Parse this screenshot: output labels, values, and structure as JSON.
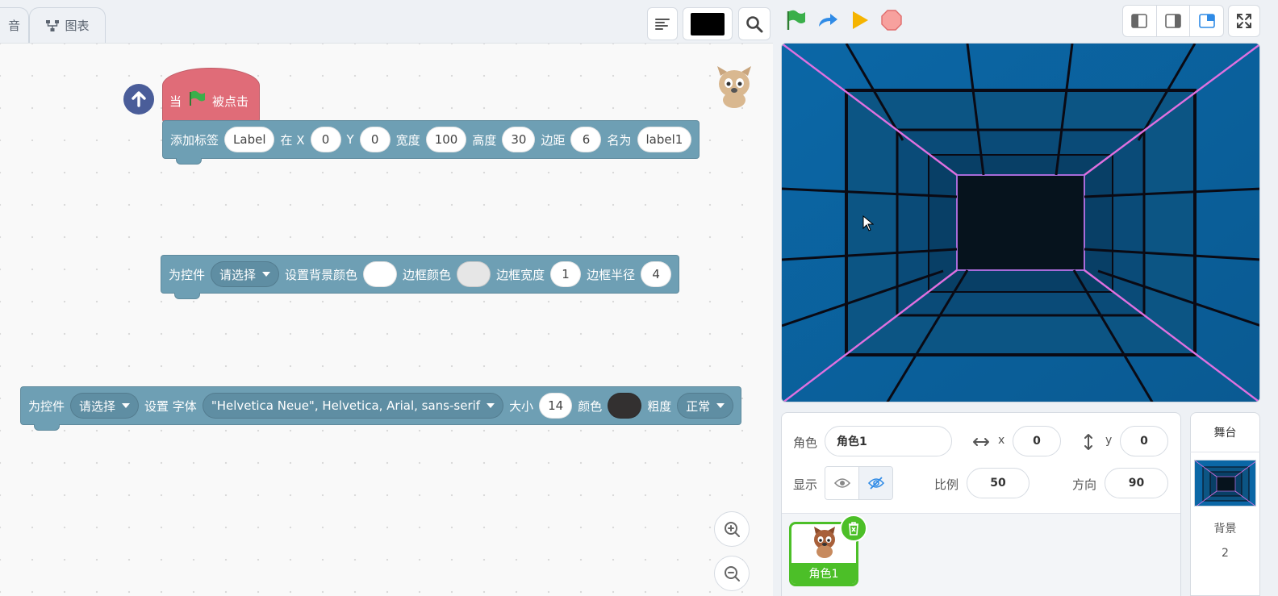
{
  "tabs": {
    "partial_label": "音",
    "chart_label": "图表"
  },
  "blocks": {
    "hat": {
      "prefix": "当",
      "suffix": "被点击"
    },
    "add_label": {
      "cmd": "添加标签",
      "text_value": "Label",
      "x_label": "在 X",
      "x_value": "0",
      "y_label": "Y",
      "y_value": "0",
      "width_label": "宽度",
      "width_value": "100",
      "height_label": "高度",
      "height_value": "30",
      "margin_label": "边距",
      "margin_value": "6",
      "name_label": "名为",
      "name_value": "label1"
    },
    "set_bg": {
      "cmd": "为控件",
      "select_value": "请选择",
      "bg_label": "设置背景颜色",
      "bg_color": "#ffffff",
      "border_color_label": "边框颜色",
      "border_color": "#e6e6e6",
      "border_width_label": "边框宽度",
      "border_width_value": "1",
      "border_radius_label": "边框半径",
      "border_radius_value": "4"
    },
    "set_font": {
      "cmd": "为控件",
      "select_value": "请选择",
      "font_label": "设置 字体",
      "font_value": "\"Helvetica Neue\", Helvetica, Arial, sans-serif",
      "size_label": "大小",
      "size_value": "14",
      "color_label": "颜色",
      "color_value": "#333030",
      "weight_label": "粗度",
      "weight_value": "正常"
    }
  },
  "sprite": {
    "name_label": "角色",
    "name_value": "角色1",
    "x_label": "x",
    "x_value": "0",
    "y_label": "y",
    "y_value": "0",
    "show_label": "显示",
    "scale_label": "比例",
    "scale_value": "50",
    "direction_label": "方向",
    "direction_value": "90",
    "tile_name": "角色1"
  },
  "stage_panel": {
    "title": "舞台",
    "bg_label": "背景",
    "bg_count": "2"
  },
  "colors": {
    "code_blue": "#6e9fb4",
    "event_red": "#e06c78",
    "sprite_green": "#4cbf28",
    "flag_green": "#2e9f4a"
  }
}
